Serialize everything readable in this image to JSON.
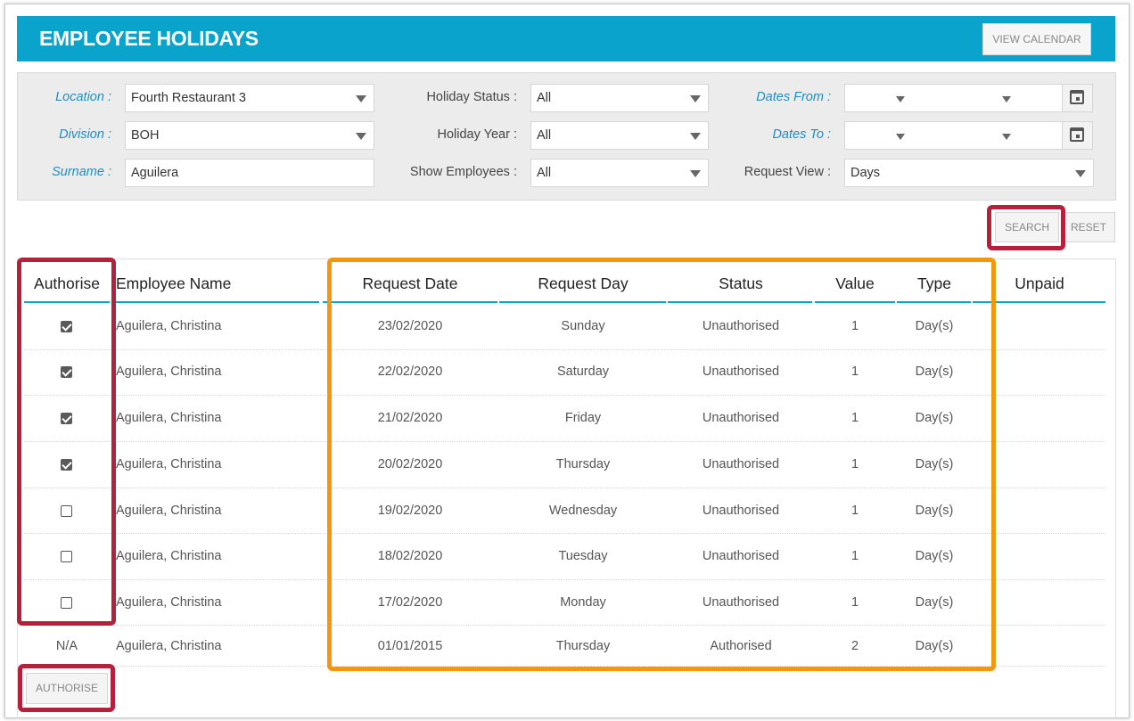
{
  "header": {
    "title": "EMPLOYEE HOLIDAYS",
    "view_calendar_label": "VIEW CALENDAR"
  },
  "filters": {
    "location_label": "Location :",
    "location_value": "Fourth Restaurant 3",
    "division_label": "Division :",
    "division_value": "BOH",
    "surname_label": "Surname :",
    "surname_value": "Aguilera",
    "holiday_status_label": "Holiday Status :",
    "holiday_status_value": "All",
    "holiday_year_label": "Holiday Year :",
    "holiday_year_value": "All",
    "show_employees_label": "Show Employees :",
    "show_employees_value": "All",
    "dates_from_label": "Dates From :",
    "dates_to_label": "Dates To :",
    "request_view_label": "Request View :",
    "request_view_value": "Days"
  },
  "actions": {
    "search_label": "SEARCH",
    "reset_label": "RESET",
    "authorise_label": "AUTHORISE"
  },
  "table": {
    "headers": [
      "Authorise",
      "Employee Name",
      "Request Date",
      "Request Day",
      "Status",
      "Value",
      "Type",
      "Unpaid"
    ],
    "rows": [
      {
        "authorise": "checked",
        "name": "Aguilera, Christina",
        "date": "23/02/2020",
        "day": "Sunday",
        "status": "Unauthorised",
        "value": "1",
        "type": "Day(s)",
        "unpaid": ""
      },
      {
        "authorise": "checked",
        "name": "Aguilera, Christina",
        "date": "22/02/2020",
        "day": "Saturday",
        "status": "Unauthorised",
        "value": "1",
        "type": "Day(s)",
        "unpaid": ""
      },
      {
        "authorise": "checked",
        "name": "Aguilera, Christina",
        "date": "21/02/2020",
        "day": "Friday",
        "status": "Unauthorised",
        "value": "1",
        "type": "Day(s)",
        "unpaid": ""
      },
      {
        "authorise": "checked",
        "name": "Aguilera, Christina",
        "date": "20/02/2020",
        "day": "Thursday",
        "status": "Unauthorised",
        "value": "1",
        "type": "Day(s)",
        "unpaid": ""
      },
      {
        "authorise": "unchecked",
        "name": "Aguilera, Christina",
        "date": "19/02/2020",
        "day": "Wednesday",
        "status": "Unauthorised",
        "value": "1",
        "type": "Day(s)",
        "unpaid": ""
      },
      {
        "authorise": "unchecked",
        "name": "Aguilera, Christina",
        "date": "18/02/2020",
        "day": "Tuesday",
        "status": "Unauthorised",
        "value": "1",
        "type": "Day(s)",
        "unpaid": ""
      },
      {
        "authorise": "unchecked",
        "name": "Aguilera, Christina",
        "date": "17/02/2020",
        "day": "Monday",
        "status": "Unauthorised",
        "value": "1",
        "type": "Day(s)",
        "unpaid": ""
      },
      {
        "authorise": "N/A",
        "name": "Aguilera, Christina",
        "date": "01/01/2015",
        "day": "Thursday",
        "status": "Authorised",
        "value": "2",
        "type": "Day(s)",
        "unpaid": ""
      }
    ]
  },
  "colors": {
    "header_bg": "#0aa3cc",
    "highlight_red": "#b5213a",
    "highlight_orange": "#f6960a",
    "label_blue": "#1a8fc7"
  }
}
